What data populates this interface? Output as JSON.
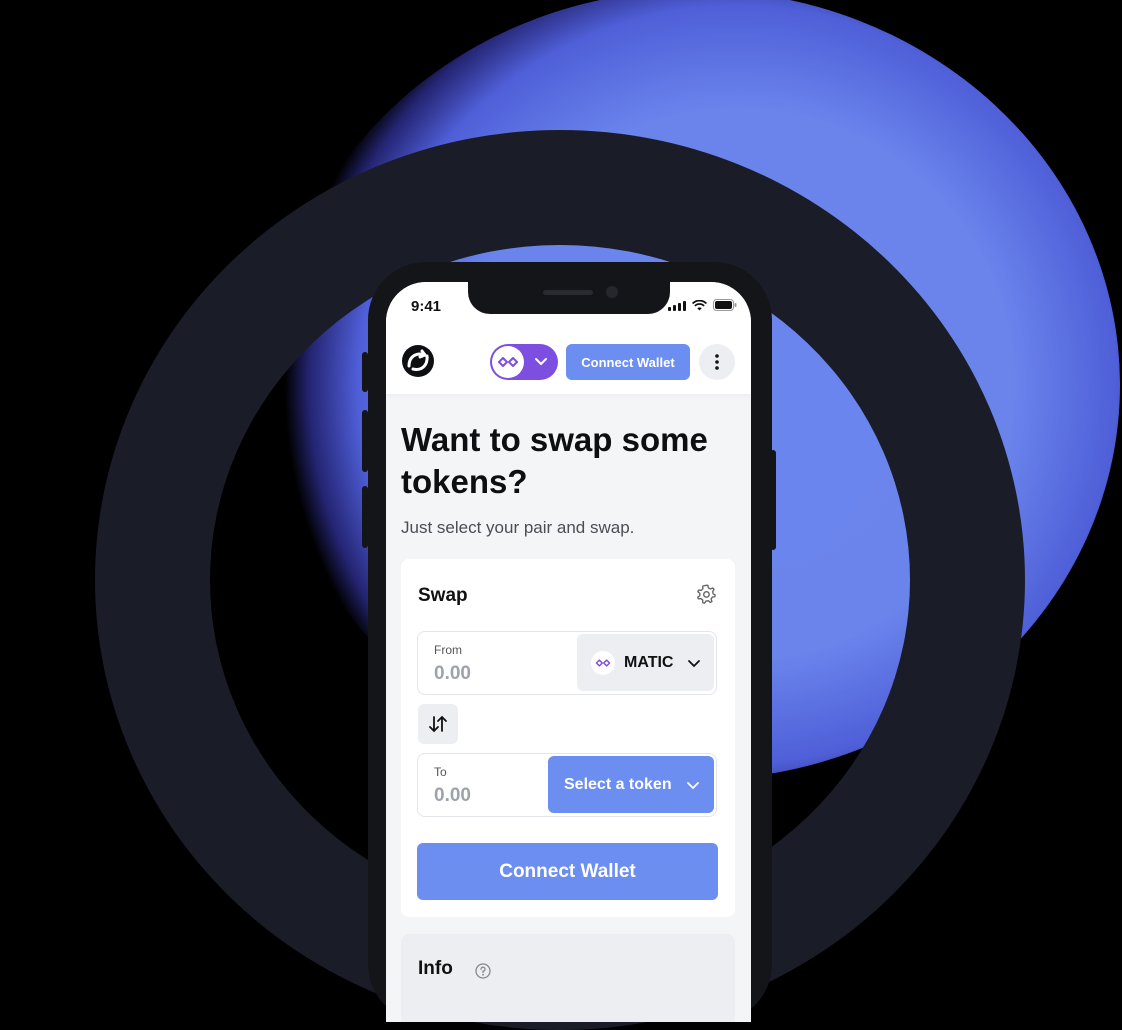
{
  "status_bar": {
    "time": "9:41"
  },
  "header": {
    "network": {
      "icon": "polygon-icon",
      "color": "#7d4fe0"
    },
    "connect_label": "Connect Wallet",
    "accent": "#6b8ef0"
  },
  "hero": {
    "title": "Want to swap some tokens?",
    "subtitle": "Just select your pair and swap."
  },
  "swap": {
    "title": "Swap",
    "from": {
      "label": "From",
      "value": "0.00",
      "token": "MATIC"
    },
    "to": {
      "label": "To",
      "value": "0.00",
      "token_placeholder": "Select a token"
    },
    "connect_label": "Connect Wallet"
  },
  "info": {
    "title": "Info"
  }
}
